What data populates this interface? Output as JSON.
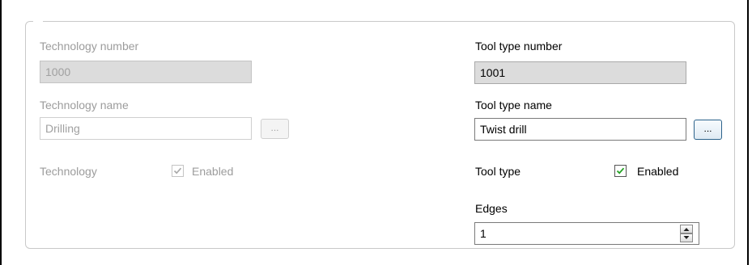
{
  "technology": {
    "number_label": "Technology number",
    "number_value": "1000",
    "name_label": "Technology name",
    "name_value": "Drilling",
    "browse_label": "...",
    "enabled_row_label": "Technology",
    "enabled_label": "Enabled",
    "enabled_checked": true
  },
  "tool_type": {
    "number_label": "Tool type number",
    "number_value": "1001",
    "name_label": "Tool type name",
    "name_value": "Twist drill",
    "browse_label": "...",
    "enabled_row_label": "Tool type",
    "enabled_label": "Enabled",
    "enabled_checked": true
  },
  "edges": {
    "label": "Edges",
    "value": "1"
  }
}
